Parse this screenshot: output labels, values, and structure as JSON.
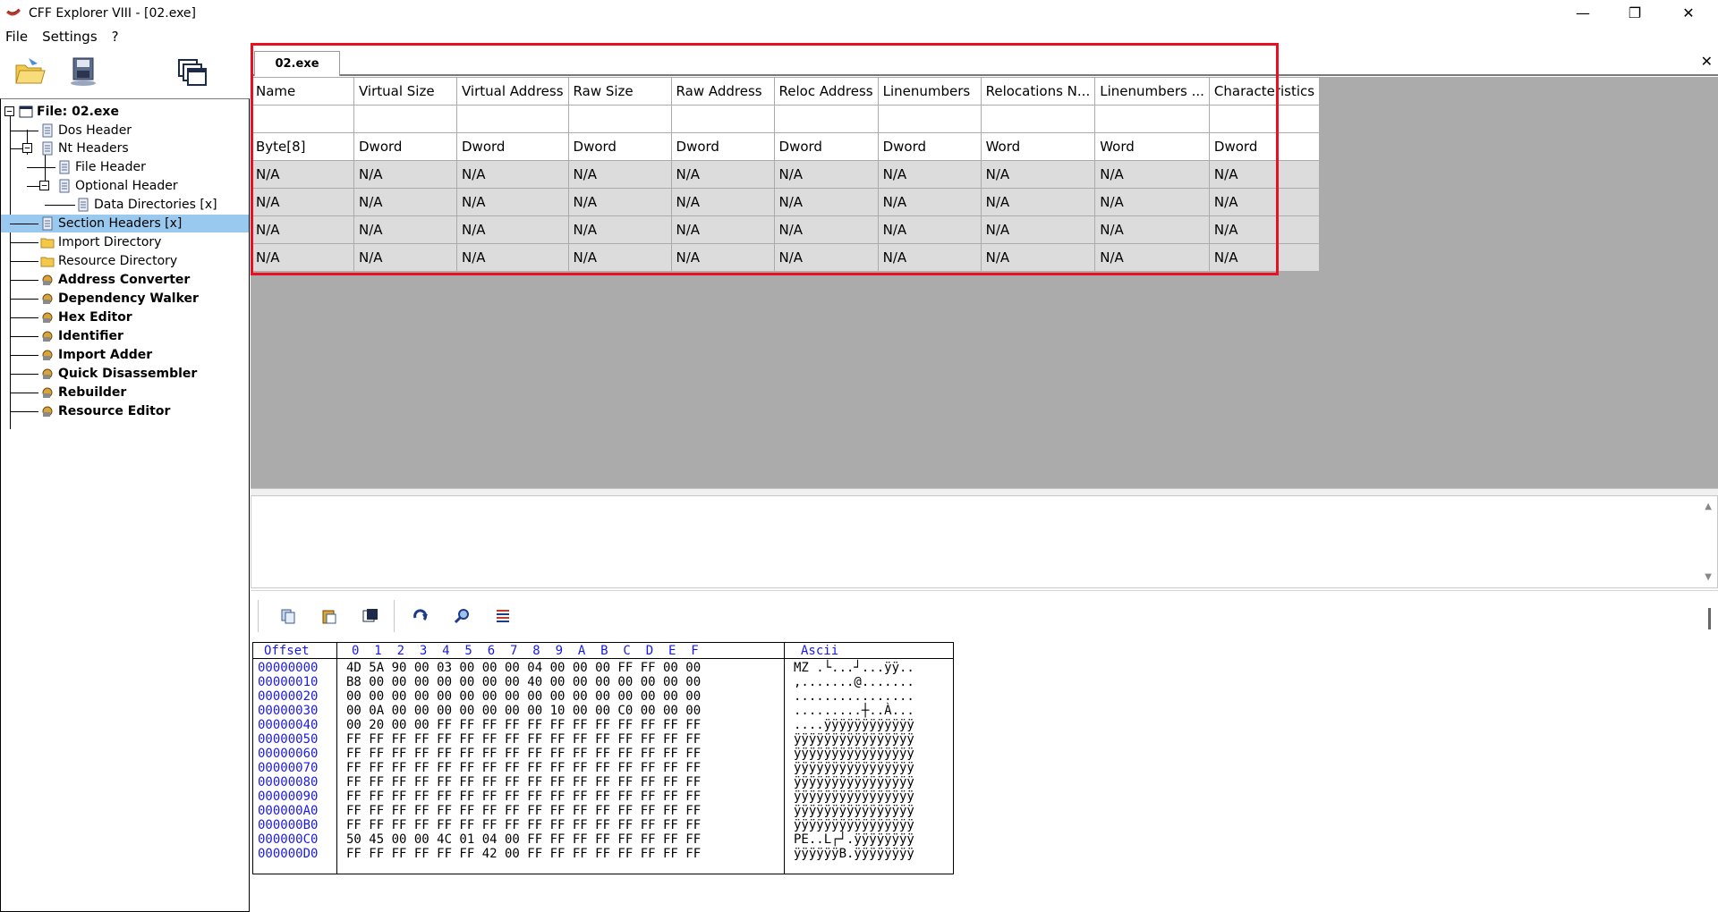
{
  "window": {
    "title": "CFF Explorer VIII - [02.exe]",
    "min_glyph": "—",
    "max_glyph": "❐",
    "close_glyph": "✕"
  },
  "menu": [
    "File",
    "Settings",
    "?"
  ],
  "toolbar": {
    "icons": [
      "open-file-icon",
      "save-file-icon",
      "windows-icon"
    ]
  },
  "tree": {
    "root": "File: 02.exe",
    "items": [
      {
        "label": "Dos Header"
      },
      {
        "label": "Nt Headers"
      },
      {
        "label": "File Header"
      },
      {
        "label": "Optional Header"
      },
      {
        "label": "Data Directories [x]"
      },
      {
        "label": "Section Headers [x]"
      },
      {
        "label": "Import Directory"
      },
      {
        "label": "Resource Directory"
      },
      {
        "label": "Address Converter"
      },
      {
        "label": "Dependency Walker"
      },
      {
        "label": "Hex Editor"
      },
      {
        "label": "Identifier"
      },
      {
        "label": "Import Adder"
      },
      {
        "label": "Quick Disassembler"
      },
      {
        "label": "Rebuilder"
      },
      {
        "label": "Resource Editor"
      }
    ]
  },
  "tab": {
    "label": "02.exe",
    "close_glyph": "✕"
  },
  "grid": {
    "headers": [
      "Name",
      "Virtual Size",
      "Virtual Address",
      "Raw Size",
      "Raw Address",
      "Reloc Address",
      "Linenumbers",
      "Relocations N...",
      "Linenumbers ...",
      "Characteristics"
    ],
    "types": [
      "Byte[8]",
      "Dword",
      "Dword",
      "Dword",
      "Dword",
      "Dword",
      "Dword",
      "Word",
      "Word",
      "Dword"
    ],
    "rows": [
      [
        "N/A",
        "N/A",
        "N/A",
        "N/A",
        "N/A",
        "N/A",
        "N/A",
        "N/A",
        "N/A",
        "N/A"
      ],
      [
        "N/A",
        "N/A",
        "N/A",
        "N/A",
        "N/A",
        "N/A",
        "N/A",
        "N/A",
        "N/A",
        "N/A"
      ],
      [
        "N/A",
        "N/A",
        "N/A",
        "N/A",
        "N/A",
        "N/A",
        "N/A",
        "N/A",
        "N/A",
        "N/A"
      ],
      [
        "N/A",
        "N/A",
        "N/A",
        "N/A",
        "N/A",
        "N/A",
        "N/A",
        "N/A",
        "N/A",
        "N/A"
      ]
    ]
  },
  "hex": {
    "offset_header": "Offset",
    "column_header": "0  1  2  3  4  5  6  7  8  9  A  B  C  D  E  F",
    "ascii_header": "Ascii",
    "rows": [
      {
        "offset": "00000000",
        "bytes": "4D 5A 90 00 03 00 00 00 04 00 00 00 FF FF 00 00",
        "ascii": "MZ .└...┘...ÿÿ.."
      },
      {
        "offset": "00000010",
        "bytes": "B8 00 00 00 00 00 00 00 40 00 00 00 00 00 00 00",
        "ascii": ",.......@......."
      },
      {
        "offset": "00000020",
        "bytes": "00 00 00 00 00 00 00 00 00 00 00 00 00 00 00 00",
        "ascii": "................"
      },
      {
        "offset": "00000030",
        "bytes": "00 0A 00 00 00 00 00 00 00 10 00 00 C0 00 00 00",
        "ascii": ".........┼..À..."
      },
      {
        "offset": "00000040",
        "bytes": "00 20 00 00 FF FF FF FF FF FF FF FF FF FF FF FF",
        "ascii": "....ÿÿÿÿÿÿÿÿÿÿÿÿ"
      },
      {
        "offset": "00000050",
        "bytes": "FF FF FF FF FF FF FF FF FF FF FF FF FF FF FF FF",
        "ascii": "ÿÿÿÿÿÿÿÿÿÿÿÿÿÿÿÿ"
      },
      {
        "offset": "00000060",
        "bytes": "FF FF FF FF FF FF FF FF FF FF FF FF FF FF FF FF",
        "ascii": "ÿÿÿÿÿÿÿÿÿÿÿÿÿÿÿÿ"
      },
      {
        "offset": "00000070",
        "bytes": "FF FF FF FF FF FF FF FF FF FF FF FF FF FF FF FF",
        "ascii": "ÿÿÿÿÿÿÿÿÿÿÿÿÿÿÿÿ"
      },
      {
        "offset": "00000080",
        "bytes": "FF FF FF FF FF FF FF FF FF FF FF FF FF FF FF FF",
        "ascii": "ÿÿÿÿÿÿÿÿÿÿÿÿÿÿÿÿ"
      },
      {
        "offset": "00000090",
        "bytes": "FF FF FF FF FF FF FF FF FF FF FF FF FF FF FF FF",
        "ascii": "ÿÿÿÿÿÿÿÿÿÿÿÿÿÿÿÿ"
      },
      {
        "offset": "000000A0",
        "bytes": "FF FF FF FF FF FF FF FF FF FF FF FF FF FF FF FF",
        "ascii": "ÿÿÿÿÿÿÿÿÿÿÿÿÿÿÿÿ"
      },
      {
        "offset": "000000B0",
        "bytes": "FF FF FF FF FF FF FF FF FF FF FF FF FF FF FF FF",
        "ascii": "ÿÿÿÿÿÿÿÿÿÿÿÿÿÿÿÿ"
      },
      {
        "offset": "000000C0",
        "bytes": "50 45 00 00 4C 01 04 00 FF FF FF FF FF FF FF FF",
        "ascii": "PE..L┌┘.ÿÿÿÿÿÿÿÿ"
      },
      {
        "offset": "000000D0",
        "bytes": "FF FF FF FF FF FF 42 00 FF FF FF FF FF FF FF FF",
        "ascii": "ÿÿÿÿÿÿB.ÿÿÿÿÿÿÿÿ"
      }
    ]
  },
  "colors": {
    "highlight_box": "#e81123",
    "selected_item": "#99c9ef",
    "hex_header": "#1a1ae6",
    "grid_background": "#ababab"
  }
}
